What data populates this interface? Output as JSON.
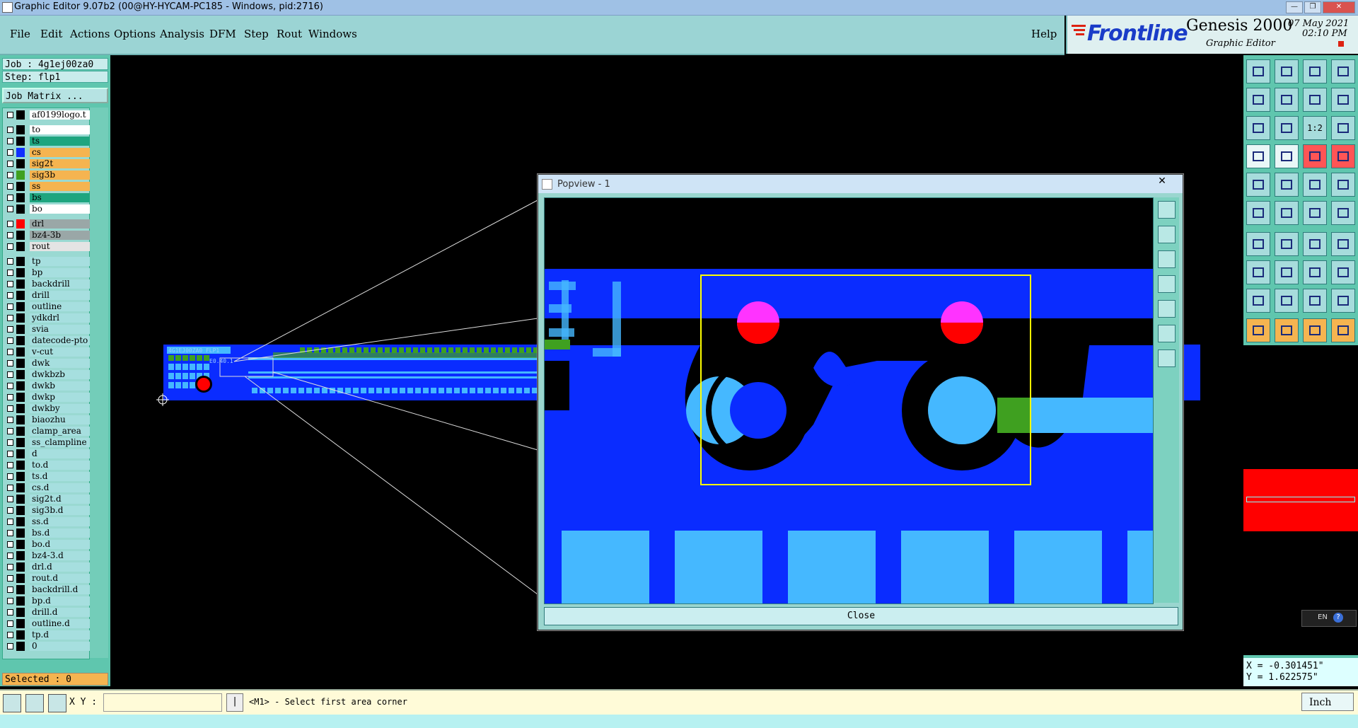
{
  "window": {
    "title": "Graphic Editor 9.07b2 (00@HY-HYCAM-PC185 - Windows, pid:2716)"
  },
  "menu": {
    "items": [
      "File",
      "Edit",
      "Actions",
      "Options",
      "Analysis",
      "DFM",
      "Step",
      "Rout",
      "Windows"
    ],
    "help": "Help"
  },
  "brand": {
    "logo": "Frontline",
    "product": "Genesis 2000",
    "subtitle": "Graphic Editor",
    "date": "07 May 2021",
    "time": "02:10 PM"
  },
  "job": {
    "job_label": "Job : 4g1ej00za0",
    "step_label": "Step: flp1",
    "matrix_button": "Job Matrix ..."
  },
  "layers": [
    {
      "name": "af0199logo.t",
      "bg": "#ffffff",
      "color": "#000000"
    },
    {
      "name": "to",
      "bg": "#ffffff",
      "color": "#000000"
    },
    {
      "name": "ts",
      "bg": "#1ea57f",
      "color": "#000000"
    },
    {
      "name": "cs",
      "bg": "#f5b450",
      "color": "#1030ff"
    },
    {
      "name": "sig2t",
      "bg": "#f5b450",
      "color": "#000000"
    },
    {
      "name": "sig3b",
      "bg": "#f5b450",
      "color": "#3fa020"
    },
    {
      "name": "ss",
      "bg": "#f5b450",
      "color": "#000000"
    },
    {
      "name": "bs",
      "bg": "#1ea57f",
      "color": "#000000"
    },
    {
      "name": "bo",
      "bg": "#ffffff",
      "color": "#000000"
    },
    {
      "name": "drl",
      "bg": "#9aa7a7",
      "color": "#ff0000",
      "marker": "▪"
    },
    {
      "name": "bz4-3b",
      "bg": "#9aa7a7",
      "color": "#000000"
    },
    {
      "name": "rout",
      "bg": "#e4e4e4",
      "color": "#000000"
    },
    {
      "name": "tp",
      "bg": "#a6dfdf",
      "color": "#000000"
    },
    {
      "name": "bp",
      "bg": "#a6dfdf",
      "color": "#000000"
    },
    {
      "name": "backdrill",
      "bg": "#a6dfdf",
      "color": "#000000"
    },
    {
      "name": "drill",
      "bg": "#a6dfdf",
      "color": "#000000"
    },
    {
      "name": "outline",
      "bg": "#a6dfdf",
      "color": "#000000"
    },
    {
      "name": "ydkdrl",
      "bg": "#a6dfdf",
      "color": "#000000"
    },
    {
      "name": "svia",
      "bg": "#a6dfdf",
      "color": "#000000"
    },
    {
      "name": "datecode-pto",
      "bg": "#a6dfdf",
      "color": "#000000"
    },
    {
      "name": "v-cut",
      "bg": "#a6dfdf",
      "color": "#000000"
    },
    {
      "name": "dwk",
      "bg": "#a6dfdf",
      "color": "#000000"
    },
    {
      "name": "dwkbzb",
      "bg": "#a6dfdf",
      "color": "#000000"
    },
    {
      "name": "dwkb",
      "bg": "#a6dfdf",
      "color": "#000000"
    },
    {
      "name": "dwkp",
      "bg": "#a6dfdf",
      "color": "#000000"
    },
    {
      "name": "dwkby",
      "bg": "#a6dfdf",
      "color": "#000000"
    },
    {
      "name": "biaozhu",
      "bg": "#a6dfdf",
      "color": "#000000"
    },
    {
      "name": "clamp_area",
      "bg": "#a6dfdf",
      "color": "#000000"
    },
    {
      "name": "ss_clampline",
      "bg": "#a6dfdf",
      "color": "#000000"
    },
    {
      "name": "d",
      "bg": "#a6dfdf",
      "color": "#000000"
    },
    {
      "name": "to.d",
      "bg": "#a6dfdf",
      "color": "#000000"
    },
    {
      "name": "ts.d",
      "bg": "#a6dfdf",
      "color": "#000000"
    },
    {
      "name": "cs.d",
      "bg": "#a6dfdf",
      "color": "#000000"
    },
    {
      "name": "sig2t.d",
      "bg": "#a6dfdf",
      "color": "#000000"
    },
    {
      "name": "sig3b.d",
      "bg": "#a6dfdf",
      "color": "#000000"
    },
    {
      "name": "ss.d",
      "bg": "#a6dfdf",
      "color": "#000000"
    },
    {
      "name": "bs.d",
      "bg": "#a6dfdf",
      "color": "#000000"
    },
    {
      "name": "bo.d",
      "bg": "#a6dfdf",
      "color": "#000000"
    },
    {
      "name": "bz4-3.d",
      "bg": "#a6dfdf",
      "color": "#000000"
    },
    {
      "name": "drl.d",
      "bg": "#a6dfdf",
      "color": "#000000"
    },
    {
      "name": "rout.d",
      "bg": "#a6dfdf",
      "color": "#000000"
    },
    {
      "name": "backdrill.d",
      "bg": "#a6dfdf",
      "color": "#000000"
    },
    {
      "name": "bp.d",
      "bg": "#a6dfdf",
      "color": "#000000"
    },
    {
      "name": "drill.d",
      "bg": "#a6dfdf",
      "color": "#000000"
    },
    {
      "name": "outline.d",
      "bg": "#a6dfdf",
      "color": "#000000"
    },
    {
      "name": "tp.d",
      "bg": "#a6dfdf",
      "color": "#000000"
    },
    {
      "name": "0",
      "bg": "#a6dfdf",
      "color": "#000000"
    }
  ],
  "selected": "Selected : 0",
  "popview": {
    "title": "Popview - 1",
    "close_label": "Close",
    "close_x": "✕"
  },
  "coords": {
    "x": "X = -0.301451\"",
    "y": "Y = 1.622575\""
  },
  "bottom": {
    "xy_label": "X Y :",
    "xy_value": "",
    "prompt": "<M1> - Select first area corner",
    "units": "Inch"
  },
  "lang": {
    "label": "EN"
  },
  "pcb": {
    "label1": "4G1EJ00ZA0 FLP1",
    "label2": "E0.40.1"
  },
  "toolbar": {
    "ratio_label": "1:2"
  },
  "colors": {
    "board_blue": "#0a2cff",
    "pad_light": "#45b8ff",
    "highlight_yellow": "#ffff00",
    "drill_red": "#ff0000",
    "magenta": "#ff33ff",
    "green": "#3fa020"
  }
}
